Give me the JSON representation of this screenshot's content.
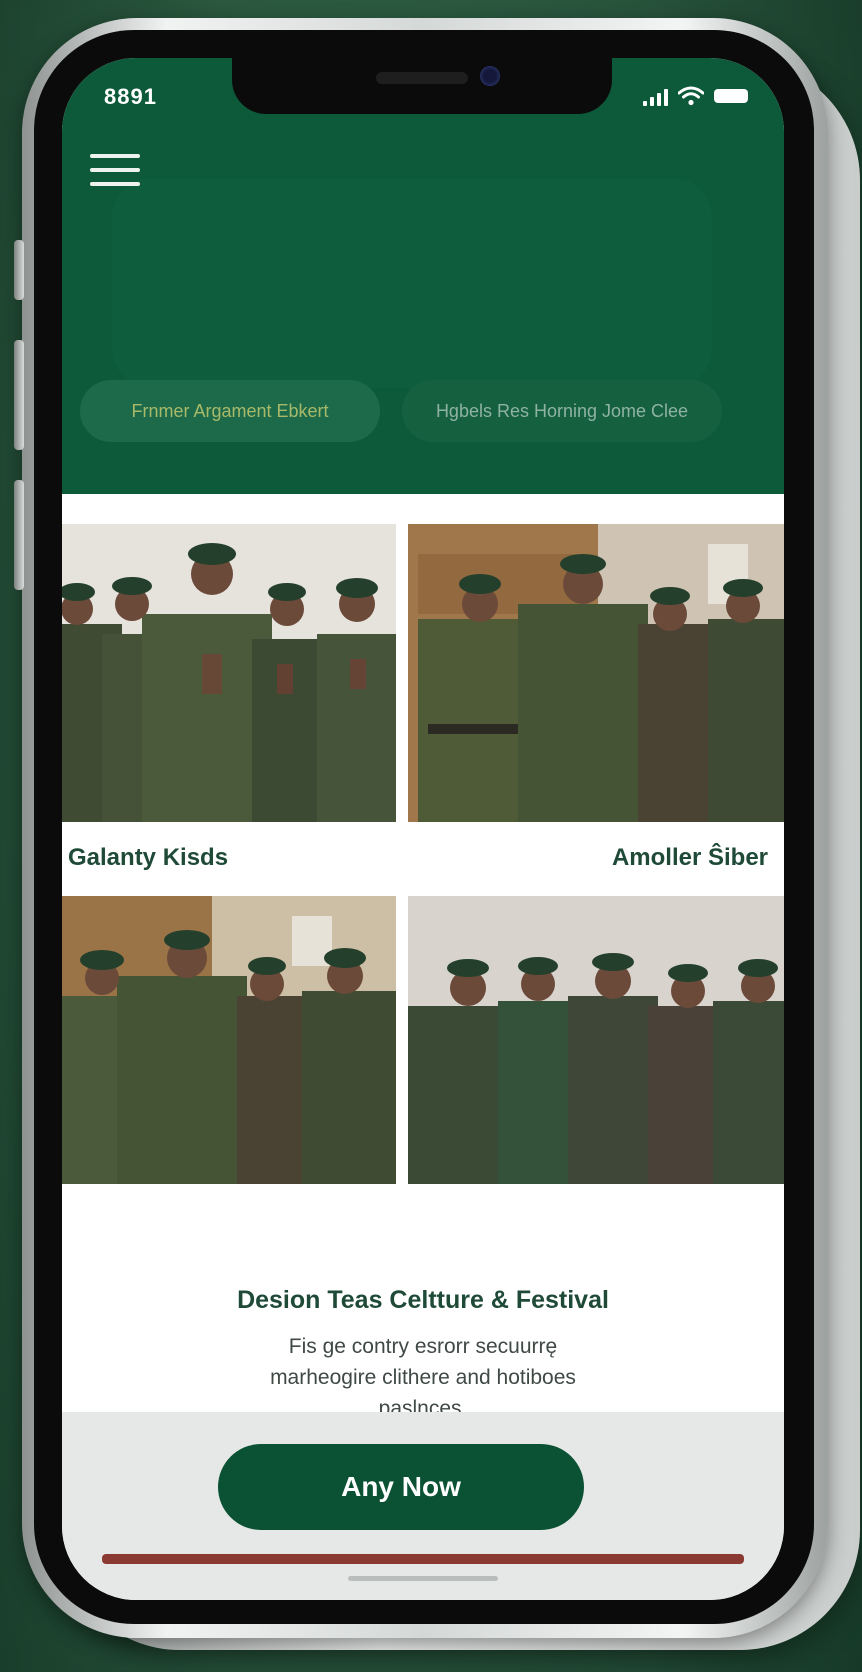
{
  "status_bar": {
    "time": "8891"
  },
  "header": {
    "menu_icon": "hamburger-icon",
    "chips": [
      {
        "label": "Frnmer Argament Ebkert"
      },
      {
        "label": "Hgbels Res Horning Jome Clee"
      }
    ]
  },
  "gallery": {
    "captions": {
      "left": "Galanty Kisds",
      "right": "Amoller Ŝiber"
    }
  },
  "description": {
    "title": "Desion Teas Celtture & Festival",
    "text": "Fis ge contry esrorr secuurrę marheogire clithere and hotiboes paslnces."
  },
  "cta": {
    "label": "Any Now"
  },
  "colors": {
    "brand_green": "#0d5a3a",
    "button_green": "#0a5233",
    "caption_green": "#1f4a38"
  }
}
